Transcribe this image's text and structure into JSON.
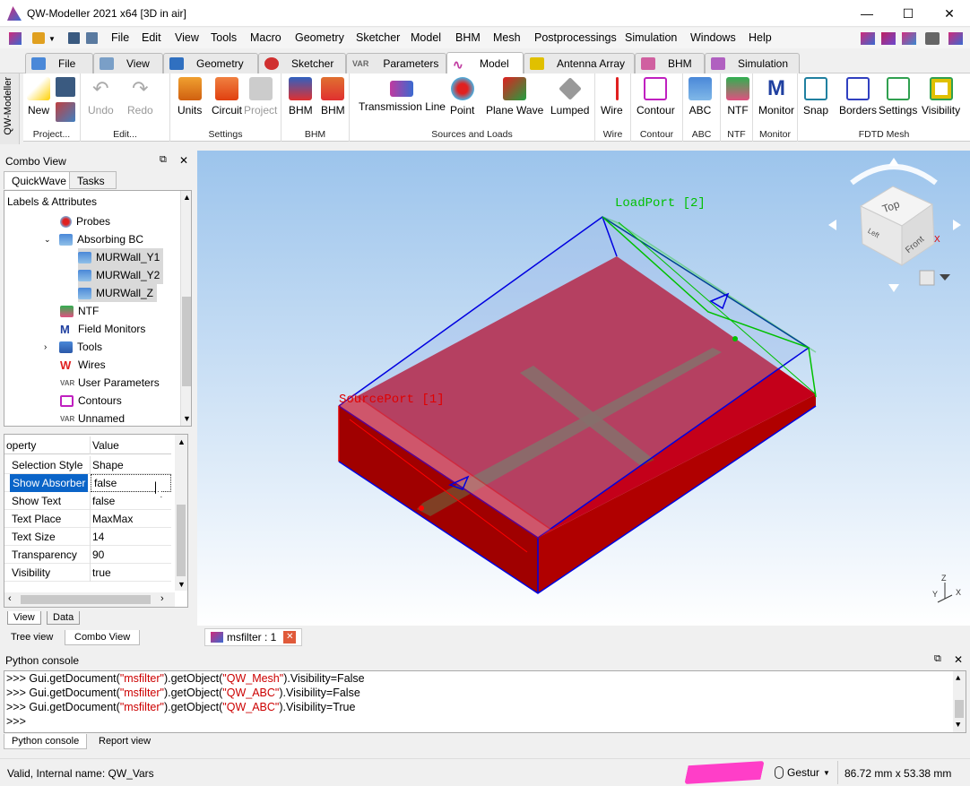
{
  "window": {
    "title": "QW-Modeller 2021 x64 [3D in air]",
    "minimize": "—",
    "maximize": "☐",
    "close": "✕"
  },
  "menubar": {
    "items": [
      "File",
      "Edit",
      "View",
      "Tools",
      "Macro",
      "Geometry",
      "Sketcher",
      "Model",
      "BHM",
      "Mesh",
      "Postprocessings",
      "Simulation",
      "Windows",
      "Help"
    ]
  },
  "tabs": [
    {
      "label": "File",
      "color": "#4a88d8"
    },
    {
      "label": "View",
      "color": "#7a9fc7"
    },
    {
      "label": "Geometry",
      "color": "#3070c0"
    },
    {
      "label": "Sketcher",
      "color": "#d03030"
    },
    {
      "label": "Parameters",
      "prefix": "VAR",
      "color": "#888888"
    },
    {
      "label": "Model",
      "color": "#c03aa0"
    },
    {
      "label": "Antenna Array",
      "color": "#e0c000"
    },
    {
      "label": "BHM",
      "color": "#d060a0"
    },
    {
      "label": "Simulation",
      "color": "#b060c0"
    }
  ],
  "side_vertical_label": "QW-Modeller",
  "ribbon": {
    "groups": [
      {
        "label": "Project...",
        "buttons": [
          "New"
        ]
      },
      {
        "label": "Edit...",
        "buttons": [
          "Undo",
          "Redo"
        ]
      },
      {
        "label": "Settings",
        "buttons": [
          "Units",
          "Circuit",
          "Project"
        ]
      },
      {
        "label": "BHM",
        "buttons": [
          "BHM",
          "BHM"
        ]
      },
      {
        "label": "Sources and Loads",
        "buttons": [
          "Transmission Line",
          "Point",
          "Plane Wave",
          "Lumped"
        ]
      },
      {
        "label": "Wire",
        "buttons": [
          "Wire"
        ]
      },
      {
        "label": "Contour",
        "buttons": [
          "Contour"
        ]
      },
      {
        "label": "ABC",
        "buttons": [
          "ABC"
        ]
      },
      {
        "label": "NTF",
        "buttons": [
          "NTF"
        ]
      },
      {
        "label": "Monitor",
        "buttons": [
          "Monitor"
        ]
      },
      {
        "label": "FDTD Mesh",
        "buttons": [
          "Snap",
          "Borders",
          "Settings",
          "Visibility"
        ]
      }
    ]
  },
  "combo_view": {
    "title": "Combo View",
    "tabs": [
      "QuickWave",
      "Tasks"
    ],
    "tree_header": "Labels & Attributes",
    "tree_items": [
      {
        "label": "Probes",
        "icon": "probe-icon"
      },
      {
        "label": "Absorbing BC",
        "icon": "absorbing-bc-icon",
        "expanded": true
      },
      {
        "label": "MURWall_Y1",
        "icon": "mur-wall-icon"
      },
      {
        "label": "MURWall_Y2",
        "icon": "mur-wall-icon"
      },
      {
        "label": "MURWall_Z",
        "icon": "mur-wall-icon"
      },
      {
        "label": "NTF",
        "icon": "ntf-icon"
      },
      {
        "label": "Field Monitors",
        "icon": "field-monitor-icon"
      },
      {
        "label": "Tools",
        "icon": "tools-icon",
        "collapsed": true
      },
      {
        "label": "Wires",
        "icon": "wires-icon"
      },
      {
        "label": "User Parameters",
        "icon": "var-icon"
      },
      {
        "label": "Contours",
        "icon": "contours-icon"
      },
      {
        "label": "Unnamed",
        "icon": "var-icon"
      }
    ],
    "prop_header": {
      "key": "operty",
      "value": "Value"
    },
    "properties": [
      {
        "key": "Selection Style",
        "value": "Shape"
      },
      {
        "key": "Show Absorber",
        "value": "false"
      },
      {
        "key": "Show Text",
        "value": "false"
      },
      {
        "key": "Text Place",
        "value": "MaxMax"
      },
      {
        "key": "Text Size",
        "value": "14"
      },
      {
        "key": "Transparency",
        "value": "90"
      },
      {
        "key": "Visibility",
        "value": "true"
      }
    ],
    "prop_tabs": [
      "View",
      "Data"
    ],
    "bottom_tabs": [
      "Tree view",
      "Combo View"
    ]
  },
  "viewport": {
    "load_port_label": "LoadPort [2]",
    "source_port_label": "SourcePort [1]",
    "navcube": {
      "top": "Top",
      "front": "Front",
      "left": "Left",
      "x": "X"
    }
  },
  "document_tab": {
    "label": "msfilter : 1"
  },
  "python_console": {
    "title": "Python console",
    "lines": [
      {
        "prompt": ">>> ",
        "pre": "Gui.getDocument(",
        "doc": "\"msfilter\"",
        "mid": ").getObject(",
        "obj": "\"QW_Mesh\"",
        "post": ").Visibility=False"
      },
      {
        "prompt": ">>> ",
        "pre": "Gui.getDocument(",
        "doc": "\"msfilter\"",
        "mid": ").getObject(",
        "obj": "\"QW_ABC\"",
        "post": ").Visibility=False"
      },
      {
        "prompt": ">>> ",
        "pre": "Gui.getDocument(",
        "doc": "\"msfilter\"",
        "mid": ").getObject(",
        "obj": "\"QW_ABC\"",
        "post": ").Visibility=True"
      }
    ],
    "empty_prompt": ">>>",
    "tabs": [
      "Python console",
      "Report view"
    ]
  },
  "status": {
    "message": "Valid, Internal name: QW_Vars",
    "nav_style": "Gestur",
    "dimensions": "86.72 mm x 53.38 mm"
  }
}
